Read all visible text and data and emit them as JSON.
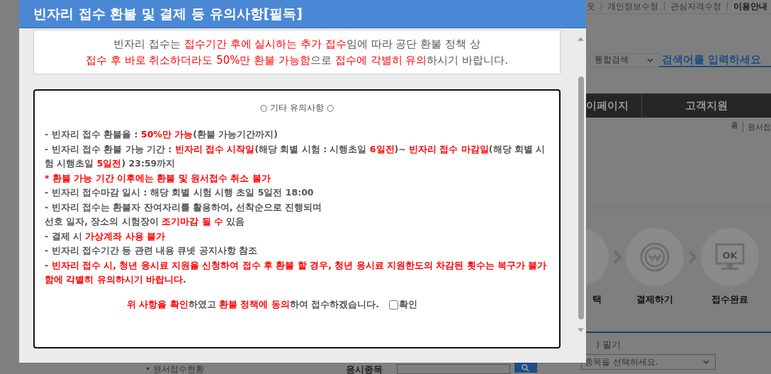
{
  "page": {
    "top_links": [
      {
        "label": "웃",
        "selected": false
      },
      {
        "label": "개인정보수정",
        "selected": false
      },
      {
        "label": "관심자격수정",
        "selected": false
      },
      {
        "label": "이용안내",
        "selected": true
      }
    ],
    "search": {
      "scope": "통합검색",
      "placeholder": "검색어를 입력하세요"
    },
    "nav": [
      {
        "label": "이페이지"
      },
      {
        "label": "고객지원"
      }
    ],
    "breadcrumb": [
      "홈",
      "원서접"
    ],
    "steps": [
      {
        "kind": "blank",
        "label": "택"
      },
      {
        "kind": "won",
        "label": "결제하기"
      },
      {
        "kind": "monitor",
        "label": "접수완료",
        "icon_text": "OK"
      }
    ],
    "section_label": ") 필기",
    "bottom": {
      "status_link": "• 원서접수현황",
      "field_label": "응시종목",
      "select": "종목을 선택하세요."
    }
  },
  "modal": {
    "title": "빈자리 접수 환불 및 결제 등 유의사항[필독]",
    "notice": [
      [
        {
          "text": "빈자리 접수는 ",
          "emphasis": false
        },
        {
          "text": "접수기간 후에 실시하는 추가 접수",
          "emphasis": true
        },
        {
          "text": "임에 따라 공단 환불 정책 상",
          "emphasis": false
        }
      ],
      [
        {
          "text": "접수 후 바로 취소하더라도 50%만 환불 가능함",
          "emphasis": true
        },
        {
          "text": "으로 ",
          "emphasis": false
        },
        {
          "text": "접수에 각별히 유의",
          "emphasis": true
        },
        {
          "text": "하시기 바랍니다.",
          "emphasis": false
        }
      ]
    ],
    "heading": "○ 기타 유의사항 ○",
    "items": [
      [
        {
          "text": "- 빈자리 접수 환불율 : ",
          "emphasis": false
        },
        {
          "text": "50%만 가능",
          "emphasis": true
        },
        {
          "text": "(환불 가능기간까지)",
          "emphasis": false
        }
      ],
      [
        {
          "text": "- 빈자리 접수 환불 가능 기간 : ",
          "emphasis": false
        },
        {
          "text": "빈자리 접수 시작일",
          "emphasis": true
        },
        {
          "text": "(해당 회별 시험 : 시행초일 ",
          "emphasis": false
        },
        {
          "text": "6일전",
          "emphasis": true
        },
        {
          "text": ")~ ",
          "emphasis": false
        },
        {
          "text": "빈자리 접수 마감일",
          "emphasis": true
        },
        {
          "text": "(해당 회별 시험 시행초일 ",
          "emphasis": false
        },
        {
          "text": "5일전",
          "emphasis": true
        },
        {
          "text": ") 23:59까지",
          "emphasis": false
        }
      ],
      [
        {
          "text": "* 환불 가능 기간 이후에는 환불 및 원서접수 취소 불가",
          "emphasis": true
        }
      ],
      [
        {
          "text": "- 빈자리 접수마감 일시 : 해당 회별 시험 시행 초일 5일전 18:00",
          "emphasis": false
        }
      ],
      [
        {
          "text": "- 빈자리 접수는 환불자 잔여자리를 활용하여, 선착순으로 진행되며",
          "emphasis": false
        }
      ],
      [
        {
          "text": "선호 일자, 장소의 시험장이 ",
          "emphasis": false
        },
        {
          "text": "조기마감 될 수",
          "emphasis": true
        },
        {
          "text": " 있음",
          "emphasis": false
        }
      ],
      [
        {
          "text": "- 결제 시 ",
          "emphasis": false
        },
        {
          "text": "가상계좌 사용 불가",
          "emphasis": true
        }
      ],
      [
        {
          "text": "- 빈자리 접수기간 등 관련 내용 큐넷 공지사항 참조",
          "emphasis": false
        }
      ],
      [
        {
          "text": "- 빈자리 접수 시, 청년 응시료 지원을 신청하여 접수 후 환불 할 경우, 청년 응시료 지원한도의 차감된 횟수는 복구가 불가함에 각별히 유의하시기 바랍니다.",
          "emphasis": true
        }
      ]
    ],
    "agreement": {
      "segments": [
        {
          "text": "위 사항을 확인",
          "emphasis": true
        },
        {
          "text": "하였고 ",
          "emphasis": false
        },
        {
          "text": "환불 정책에 동의",
          "emphasis": true
        },
        {
          "text": "하여 접수하겠습니다.",
          "emphasis": false
        }
      ],
      "checkbox_label": "확인",
      "checked": false
    }
  }
}
